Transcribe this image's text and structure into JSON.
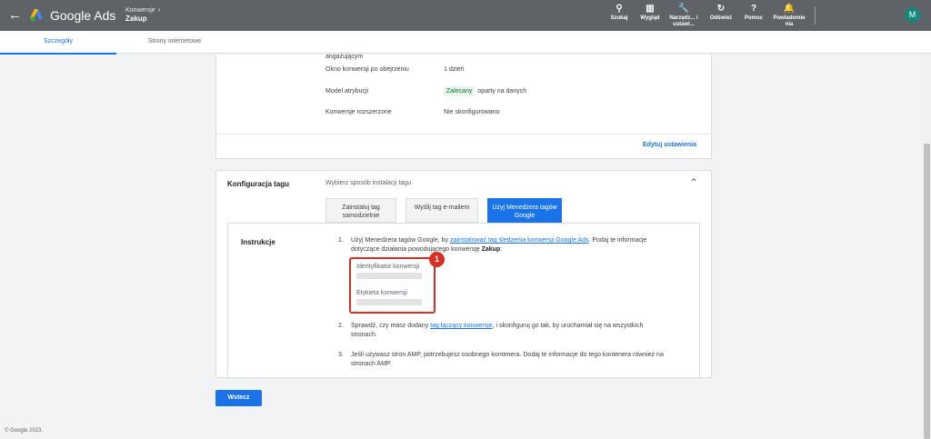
{
  "header": {
    "brand": "Google Ads",
    "breadcrumb": "Konwersje",
    "breadcrumb_sep": "›",
    "page_title": "Zakup",
    "tools": [
      {
        "icon": "search-icon",
        "glyph": "⚲",
        "label": "Szukaj"
      },
      {
        "icon": "appearance-icon",
        "glyph": "▥",
        "label": "Wygląd"
      },
      {
        "icon": "wrench-icon",
        "glyph": "🔧",
        "label": "Narzędz... i ustawi..."
      },
      {
        "icon": "refresh-icon",
        "glyph": "↻",
        "label": "Odśwież"
      },
      {
        "icon": "help-icon",
        "glyph": "?",
        "label": "Pomoc"
      },
      {
        "icon": "bell-icon",
        "glyph": "🔔",
        "label": "Powiadomie nia"
      }
    ],
    "avatar_letter": "M",
    "avatar_color": "#12887d"
  },
  "tabs": [
    "Szczegóły",
    "Strony internetowe"
  ],
  "settings": {
    "cut_text": "angażującym",
    "rows": [
      {
        "label": "Okno konwersji po obejrzeniu",
        "value": "1 dzień"
      },
      {
        "label": "Model atrybucji",
        "chip": "Zalecany",
        "value": "oparty na danych"
      },
      {
        "label": "Konwersje rozszerzone",
        "value": "Nie skonfigurowano"
      }
    ],
    "edit_link": "Edytuj ustawienia"
  },
  "tag_config": {
    "title": "Konfiguracja tagu",
    "subtitle": "Wybierz sposób instalacji tagu",
    "options": [
      "Zainstaluj tag samodzielnie",
      "Wyślij tag e-mailem",
      "Użyj Menedżera tagów Google"
    ],
    "active_option_index": 2,
    "instructions_title": "Instrukcje",
    "step1": {
      "num": "1.",
      "pre": "Użyj Menedżera tagów Google, by ",
      "link": "zainstalować tag śledzenia konwersji Google Ads",
      "post": ". Podaj te informacje dotyczące działania powodującego konwersję ",
      "bold": "Zakup",
      "end": ":"
    },
    "fields": [
      {
        "label": "Identyfikator konwersji"
      },
      {
        "label": "Etykieta konwersji"
      }
    ],
    "badge": "1",
    "step2": {
      "num": "2.",
      "pre": "Sprawdź, czy masz dodany ",
      "link": "tag łączący konwersje",
      "post": ", i skonfiguruj go tak, by uruchamiał się na wszystkich stronach."
    },
    "step3": {
      "num": "3.",
      "text": "Jeśli używasz stron AMP, potrzebujesz osobnego kontenera. Dodaj te informacje do tego kontenera również na stronach AMP."
    }
  },
  "back_button": "Wstecz",
  "footer": "© Google 2023."
}
